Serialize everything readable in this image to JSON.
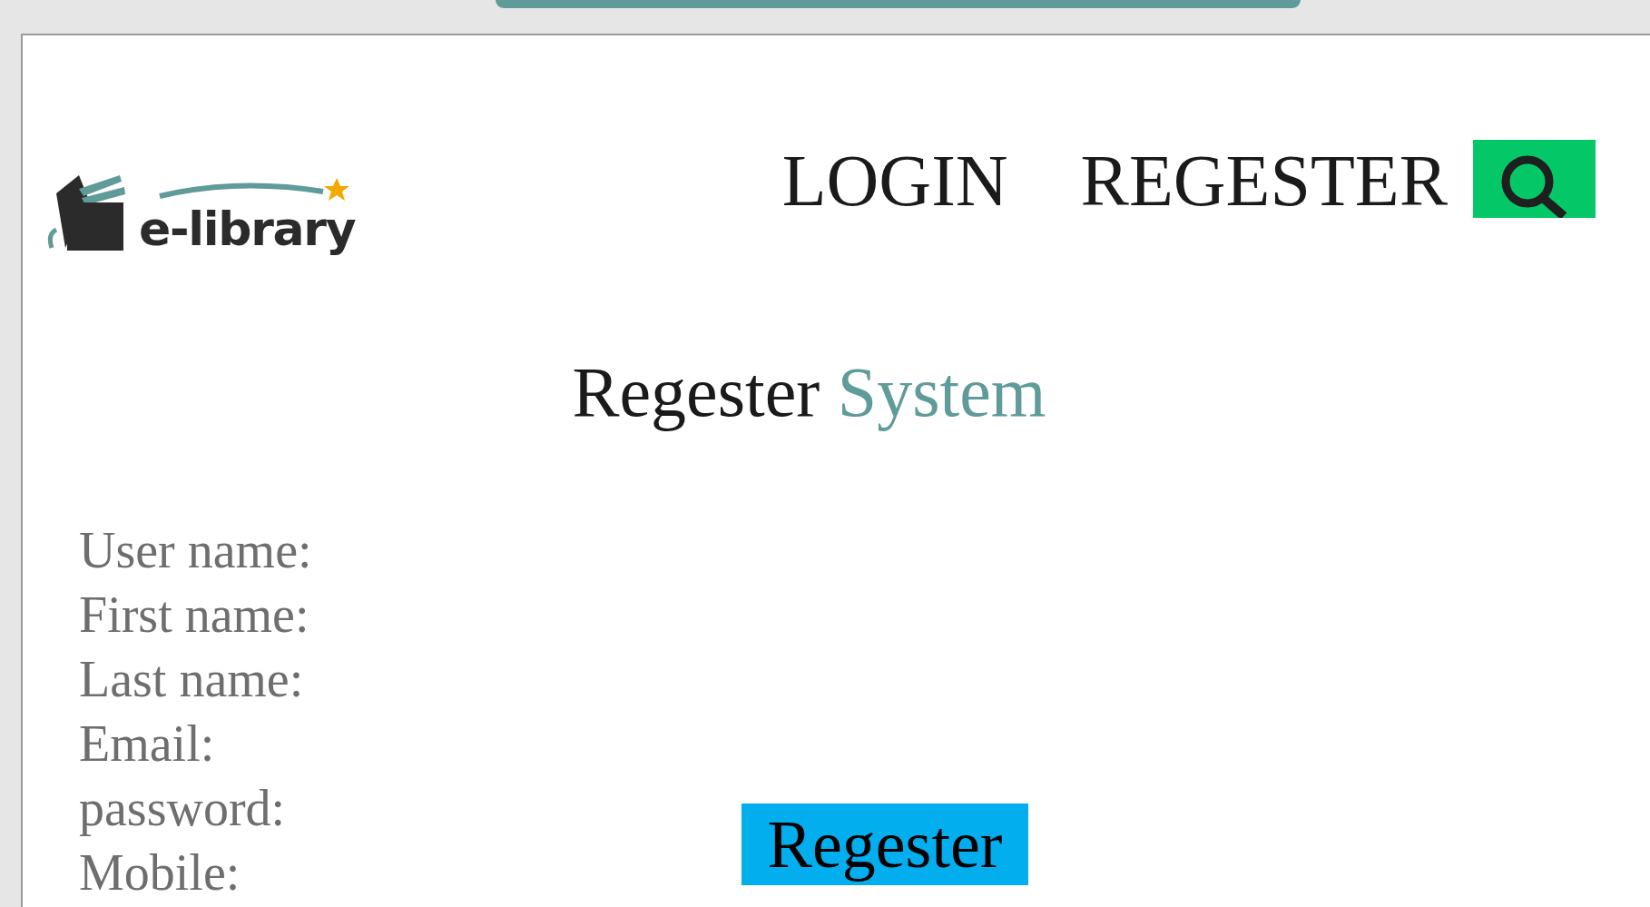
{
  "logo": {
    "text": "e-library"
  },
  "nav": {
    "links": [
      {
        "label": "LOGIN"
      },
      {
        "label": "REGESTER"
      }
    ]
  },
  "heading": {
    "text": "Regester",
    "accent": "System"
  },
  "form": {
    "labels": [
      "User name:",
      "First name:",
      "Last name:",
      "Email:",
      "password:",
      "Mobile:"
    ],
    "submit": "Regester"
  }
}
